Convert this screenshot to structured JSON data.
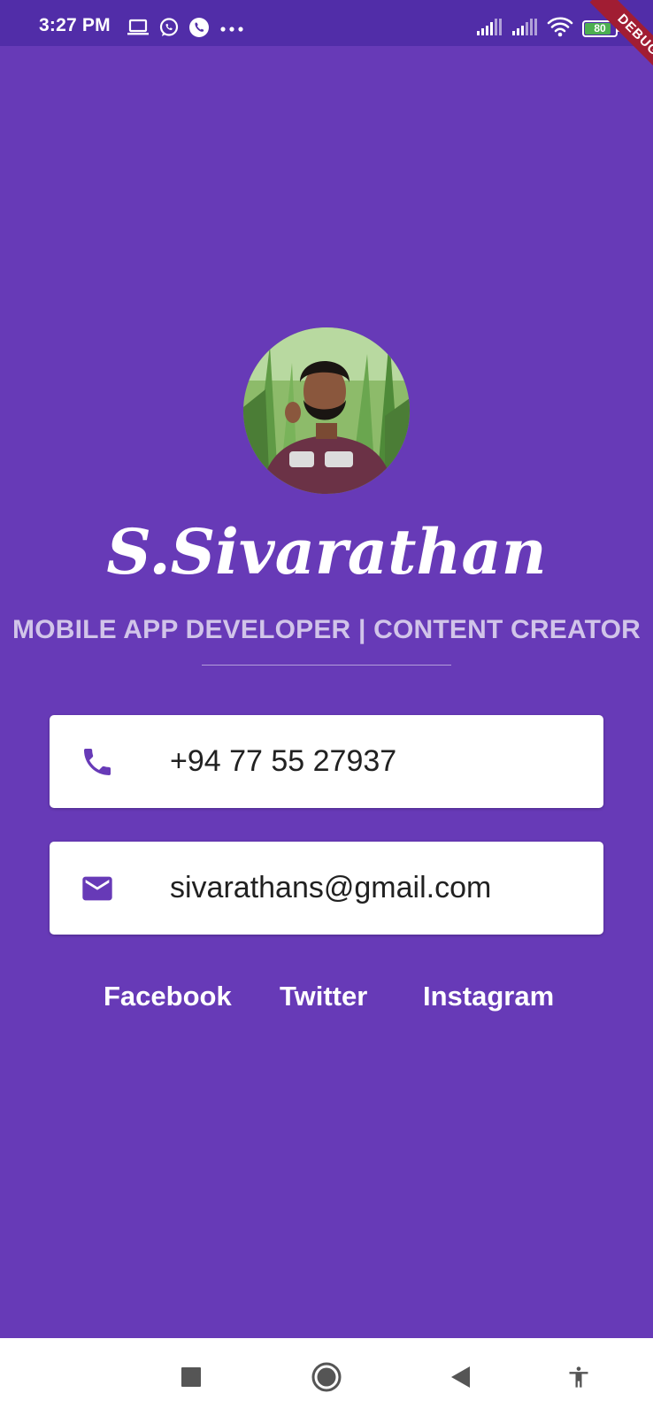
{
  "status_bar": {
    "time": "3:27 PM",
    "icons": [
      "laptop-icon",
      "whatsapp-icon",
      "phone-call-icon",
      "more-dots-icon",
      "signal-icon",
      "signal-icon",
      "wifi-icon",
      "battery-icon"
    ],
    "battery_level": "80",
    "battery_fraction": 0.8,
    "background_color": "#512da8"
  },
  "debug_banner": {
    "label": "DEBUG",
    "color": "#a11d33"
  },
  "profile": {
    "name": "S.Sivarathan",
    "tagline": "MOBILE APP DEVELOPER | CONTENT CREATOR",
    "avatar_icon": "profile-photo"
  },
  "contact": {
    "phone": "+94 77 55 27937",
    "phone_icon": "phone-icon",
    "email": "sivarathans@gmail.com",
    "email_icon": "mail-icon"
  },
  "social": {
    "facebook": "Facebook",
    "twitter": "Twitter",
    "instagram": "Instagram"
  },
  "nav_bar": {
    "icons": [
      "recents-square-icon",
      "home-circle-icon",
      "back-triangle-icon",
      "accessibility-icon"
    ]
  },
  "colors": {
    "background": "#673ab7",
    "accent": "#673ab7",
    "tagline": "#d1c4e9",
    "card": "#ffffff"
  }
}
